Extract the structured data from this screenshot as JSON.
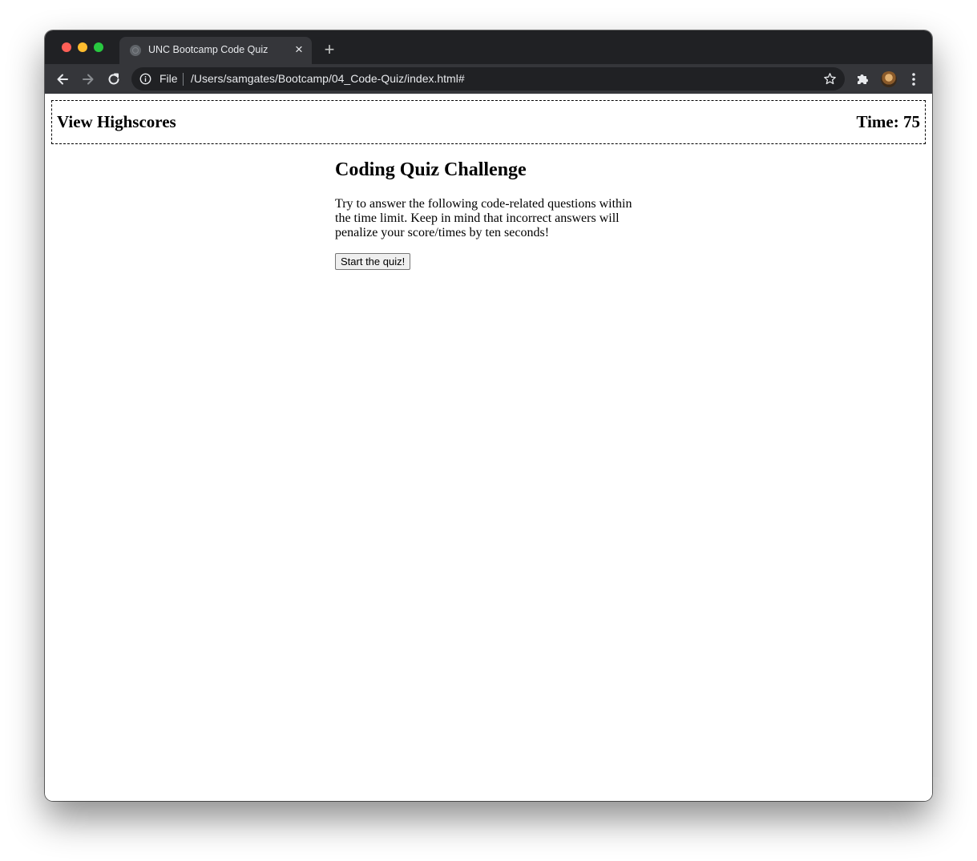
{
  "browser": {
    "tab_title": "UNC Bootcamp Code Quiz",
    "tab_close": "×",
    "new_tab": "+",
    "scheme_label": "File",
    "url": "/Users/samgates/Bootcamp/04_Code-Quiz/index.html#"
  },
  "page": {
    "highscores_link": "View Highscores",
    "timer": "Time: 75",
    "title": "Coding Quiz Challenge",
    "instructions": "Try to answer the following code-related questions within the time limit. Keep in mind that incorrect answers will penalize your score/times by ten seconds!",
    "start_button": "Start the quiz!"
  },
  "colors": {
    "titlebar": "#202124",
    "toolbar": "#35363a",
    "close_dot": "#ff5f57",
    "minimize_dot": "#febc2e",
    "zoom_dot": "#28c840"
  },
  "icons": [
    "globe-icon",
    "back-arrow-icon",
    "forward-arrow-icon",
    "reload-icon",
    "info-icon",
    "star-icon",
    "puzzle-icon",
    "kebab-menu-icon"
  ]
}
